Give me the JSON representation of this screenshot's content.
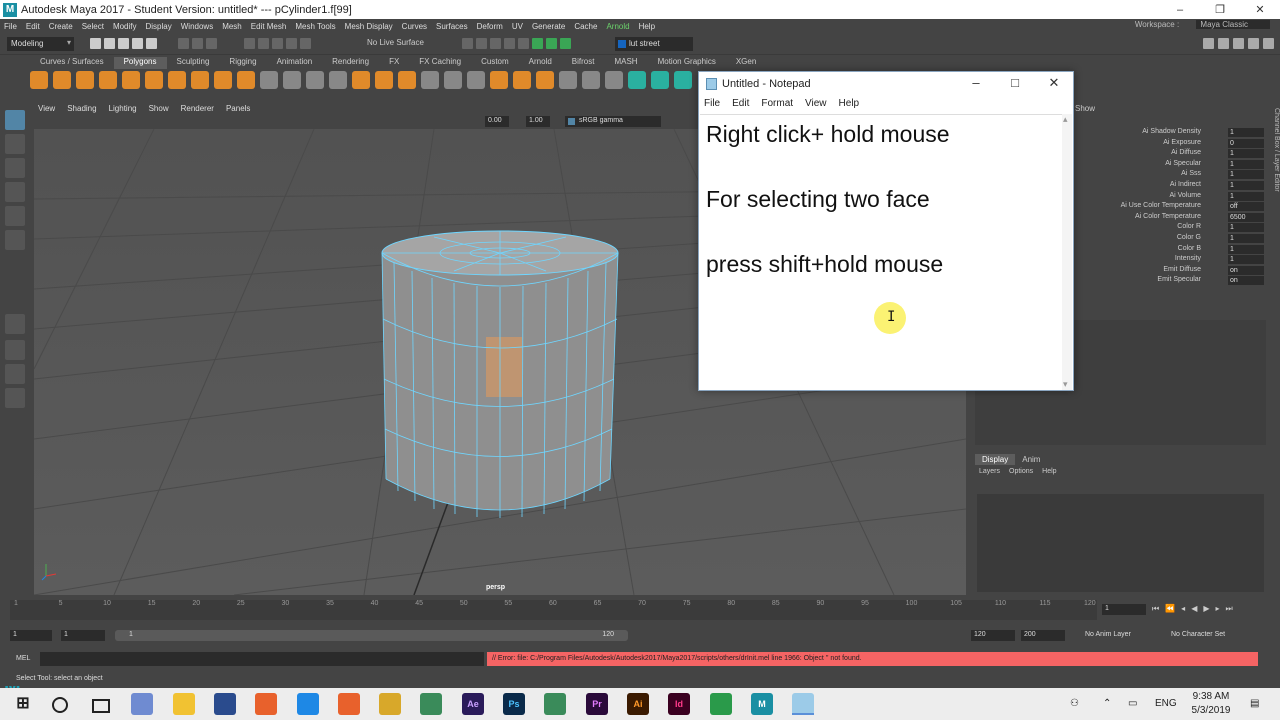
{
  "window": {
    "title": "Autodesk Maya 2017 - Student Version: untitled*   ---   pCylinder1.f[99]",
    "logo": "M"
  },
  "menubar": {
    "items": [
      "File",
      "Edit",
      "Create",
      "Select",
      "Modify",
      "Display",
      "Windows",
      "Mesh",
      "Edit Mesh",
      "Mesh Tools",
      "Mesh Display",
      "Curves",
      "Surfaces",
      "Deform",
      "UV",
      "Generate",
      "Cache"
    ],
    "arnold": "Arnold",
    "help": "Help",
    "workspace_label": "Workspace :",
    "workspace_value": "Maya Classic"
  },
  "statusline": {
    "mode": "Modeling",
    "live_surface": "No Live Surface",
    "camera": "lut street"
  },
  "shelf": {
    "tabs": [
      "Curves / Surfaces",
      "Polygons",
      "Sculpting",
      "Rigging",
      "Animation",
      "Rendering",
      "FX",
      "FX Caching",
      "Custom",
      "Arnold",
      "Bifrost",
      "MASH",
      "Motion Graphics",
      "XGen"
    ],
    "active_tab": "Polygons"
  },
  "viewport": {
    "menu": [
      "View",
      "Shading",
      "Lighting",
      "Show",
      "Renderer",
      "Panels"
    ],
    "value_a": "0.00",
    "value_b": "1.00",
    "color_space": "sRGB gamma",
    "camera_label": "persp"
  },
  "channel_box": {
    "show": "Show",
    "attributes": [
      {
        "label": "Ai Shadow Density",
        "value": "1"
      },
      {
        "label": "Ai Exposure",
        "value": "0"
      },
      {
        "label": "Ai Diffuse",
        "value": "1"
      },
      {
        "label": "Ai Specular",
        "value": "1"
      },
      {
        "label": "Ai Sss",
        "value": "1"
      },
      {
        "label": "Ai Indirect",
        "value": "1"
      },
      {
        "label": "Ai Volume",
        "value": "1"
      },
      {
        "label": "Ai Use Color Temperature",
        "value": "off"
      },
      {
        "label": "Ai Color Temperature",
        "value": "6500"
      },
      {
        "label": "Color R",
        "value": "1"
      },
      {
        "label": "Color G",
        "value": "1"
      },
      {
        "label": "Color B",
        "value": "1"
      },
      {
        "label": "Intensity",
        "value": "1"
      },
      {
        "label": "Emit Diffuse",
        "value": "on"
      },
      {
        "label": "Emit Specular",
        "value": "on"
      }
    ],
    "side_tabs": "Channel Box / Layer Editor"
  },
  "layer_editor": {
    "tabs": [
      "Display",
      "Anim"
    ],
    "menu": [
      "Layers",
      "Options",
      "Help"
    ]
  },
  "timeslider": {
    "ticks": [
      "1",
      "5",
      "10",
      "15",
      "20",
      "25",
      "30",
      "35",
      "40",
      "45",
      "50",
      "55",
      "60",
      "65",
      "70",
      "75",
      "80",
      "85",
      "90",
      "95",
      "100",
      "105",
      "110",
      "115",
      "120"
    ],
    "current_frame": "1"
  },
  "rangeslider": {
    "start": "1",
    "range_start": "1",
    "range_bar_start": "1",
    "range_bar_end": "120",
    "range_end": "120",
    "end": "200",
    "anim_layer": "No Anim Layer",
    "character_set": "No Character Set"
  },
  "cmdline": {
    "language": "MEL",
    "error": "// Error: file: C:/Program Files/Autodesk/Autodesk2017/Maya2017/scripts/others/drInit.mel line 1966: Object '' not found."
  },
  "helpline": {
    "text": "Select Tool: select an object"
  },
  "notepad": {
    "title": "Untitled - Notepad",
    "menu": [
      "File",
      "Edit",
      "Format",
      "View",
      "Help"
    ],
    "lines": [
      "Right click+ hold mouse",
      "For selecting two face",
      "press shift+hold mouse"
    ]
  },
  "taskbar": {
    "apps": [
      "Ae",
      "Ps",
      "Pr",
      "Ai",
      "Id",
      "M"
    ],
    "language": "ENG",
    "time": "9:38 AM",
    "date": "5/3/2019"
  },
  "colors": {
    "maya_bg": "#444444",
    "viewport": "#585858",
    "wireframe": "#6fd6ff",
    "selection": "#e89a5a",
    "error": "#f56464"
  }
}
